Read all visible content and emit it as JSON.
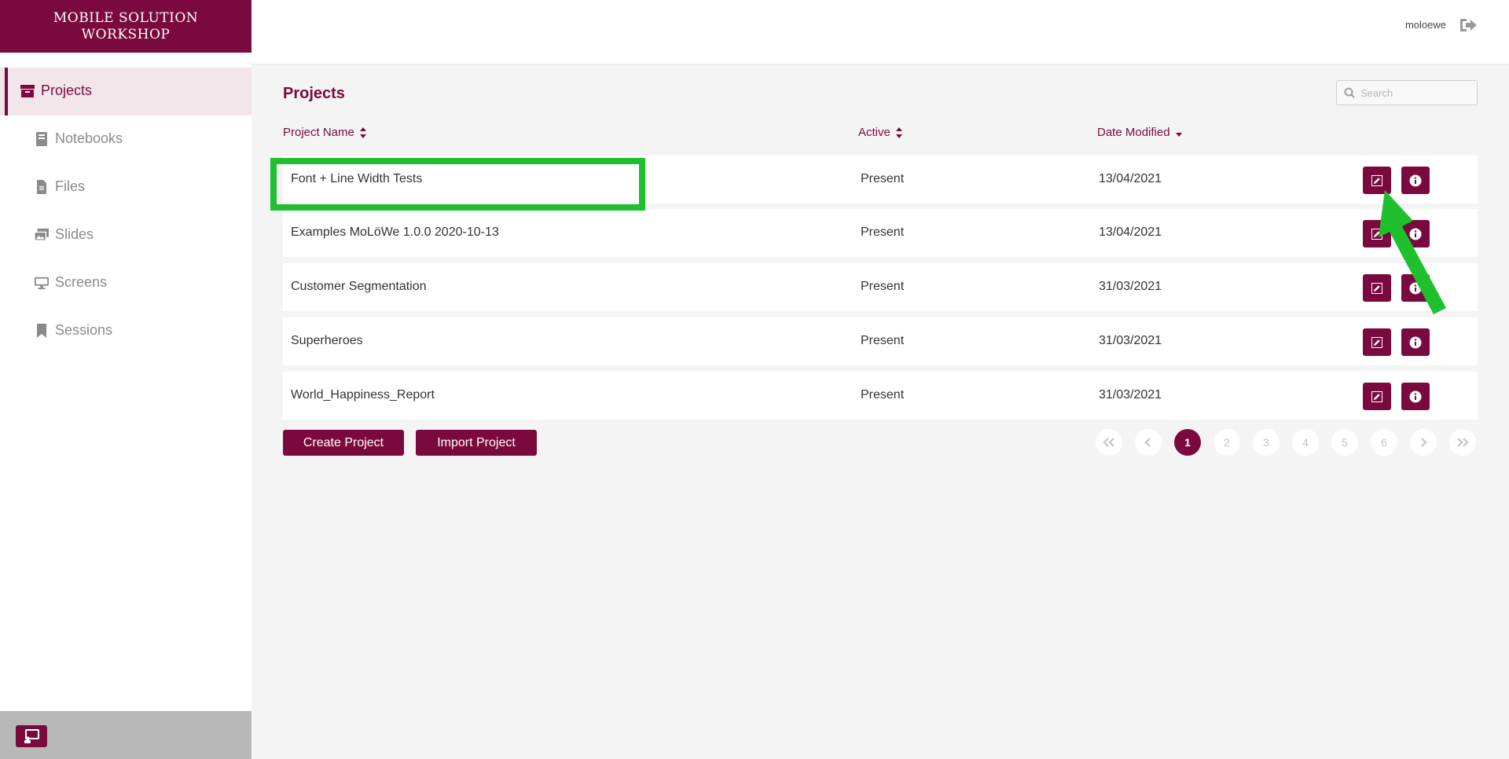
{
  "brand": {
    "line1": "MOBILE SOLUTION",
    "line2": "WORKSHOP"
  },
  "sidebar": {
    "items": [
      {
        "label": "Projects",
        "icon": "archive-icon",
        "active": true
      },
      {
        "label": "Notebooks",
        "icon": "book-icon",
        "active": false
      },
      {
        "label": "Files",
        "icon": "file-icon",
        "active": false
      },
      {
        "label": "Slides",
        "icon": "images-icon",
        "active": false
      },
      {
        "label": "Screens",
        "icon": "monitor-icon",
        "active": false
      },
      {
        "label": "Sessions",
        "icon": "bookmark-icon",
        "active": false
      }
    ],
    "footer_icon": "presentation-icon"
  },
  "header": {
    "user": "moloewe",
    "logout_icon": "sign-out-icon"
  },
  "main": {
    "title": "Projects",
    "search": {
      "placeholder": "Search",
      "value": ""
    },
    "columns": {
      "name": "Project Name",
      "active": "Active",
      "date": "Date Modified"
    },
    "rows": [
      {
        "name": "Font + Line Width Tests",
        "active": "Present",
        "date": "13/04/2021"
      },
      {
        "name": "Examples MoLöWe 1.0.0 2020-10-13",
        "active": "Present",
        "date": "13/04/2021"
      },
      {
        "name": "Customer Segmentation",
        "active": "Present",
        "date": "31/03/2021"
      },
      {
        "name": "Superheroes",
        "active": "Present",
        "date": "31/03/2021"
      },
      {
        "name": "World_Happiness_Report",
        "active": "Present",
        "date": "31/03/2021"
      }
    ],
    "buttons": {
      "create": "Create Project",
      "import": "Import Project"
    },
    "pagination": {
      "pages": [
        "1",
        "2",
        "3",
        "4",
        "5",
        "6"
      ],
      "current": "1"
    }
  },
  "colors": {
    "brand": "#7a0a3d",
    "active_nav_bg": "#f3e6eb",
    "annotation": "#1fbf2e"
  }
}
